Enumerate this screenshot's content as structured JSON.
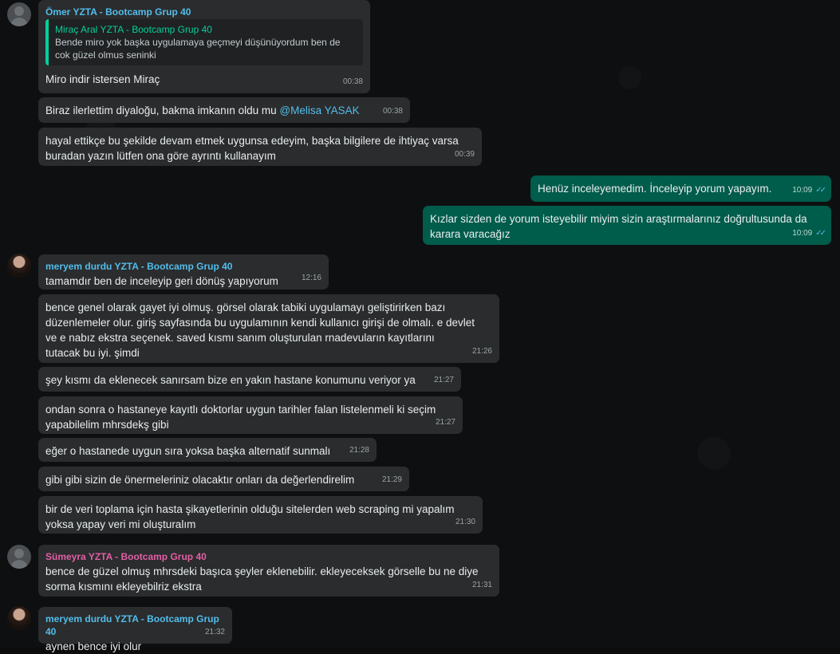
{
  "messages": [
    {
      "sender": "Ömer YZTA - Bootcamp Grup 40",
      "sender_color": "#53bdeb",
      "quote": {
        "name": "Miraç Aral YZTA - Bootcamp Grup 40",
        "text": "Bende miro yok başka uygulamaya geçmeyi düşünüyordum ben de cok güzel olmus seninki"
      },
      "text": "Miro indir istersen Miraç",
      "time": "00:38"
    },
    {
      "text": "Biraz ilerlettim diyaloğu, bakma imkanın oldu mu ",
      "mention": "@Melisa YASAK",
      "time": "00:38"
    },
    {
      "text": "hayal ettikçe bu şekilde devam etmek uygunsa edeyim, başka bilgilere de ihtiyaç varsa\nburadan yazın lütfen ona göre ayrıntı kullanayım",
      "time": "00:39"
    },
    {
      "text": "Henüz inceleyemedim. İnceleyip yorum yapayım.",
      "time": "10:09"
    },
    {
      "text": "Kızlar sizden de yorum isteyebilir miyim sizin araştırmalarınız doğrultusunda da\nkarara varacağız",
      "time": "10:09"
    },
    {
      "sender": "meryem durdu YZTA - Bootcamp Grup 40",
      "sender_color": "#53bdeb",
      "text": "tamamdır ben de inceleyip geri dönüş yapıyorum",
      "time": "12:16"
    },
    {
      "text": "bence genel olarak gayet iyi olmuş. görsel olarak tabiki uygulamayı geliştirirken bazı\ndüzenlemeler olur. giriş sayfasında bu uygulamının kendi kullanıcı girişi de olmalı. e devlet\nve e nabız ekstra seçenek. saved kısmı sanım oluşturulan rnadevuların kayıtlarını\ntutacak bu iyi. şimdi",
      "time": "21:26"
    },
    {
      "text": "şey kısmı da eklenecek sanırsam bize en yakın hastane konumunu veriyor ya",
      "time": "21:27"
    },
    {
      "text": "ondan sonra o hastaneye kayıtlı doktorlar uygun tarihler falan listelenmeli ki seçim\nyapabilelim mhrsdekş gibi",
      "time": "21:27"
    },
    {
      "text": "eğer o hastanede uygun sıra yoksa başka alternatif sunmalı",
      "time": "21:28"
    },
    {
      "text": "gibi gibi sizin de önermeleriniz olacaktır onları da değerlendirelim",
      "time": "21:29"
    },
    {
      "text": "bir de veri toplama için hasta şikayetlerinin olduğu sitelerden web scraping mi yapalım\nyoksa yapay veri mi oluşturalım",
      "time": "21:30"
    },
    {
      "sender": "Sümeyra YZTA - Bootcamp Grup 40",
      "sender_color": "#e25fa4",
      "text": "bence de güzel olmuş mhrsdeki başıca şeyler eklenebilir. ekleyeceksek görselle bu ne diye\nsorma kısmını ekleyebilriz ekstra",
      "time": "21:31"
    },
    {
      "sender": "meryem durdu YZTA - Bootcamp Grup 40",
      "sender_color": "#53bdeb",
      "text": "aynen bence iyi olur",
      "time": "21:32"
    }
  ],
  "read_ticks": "✓✓"
}
